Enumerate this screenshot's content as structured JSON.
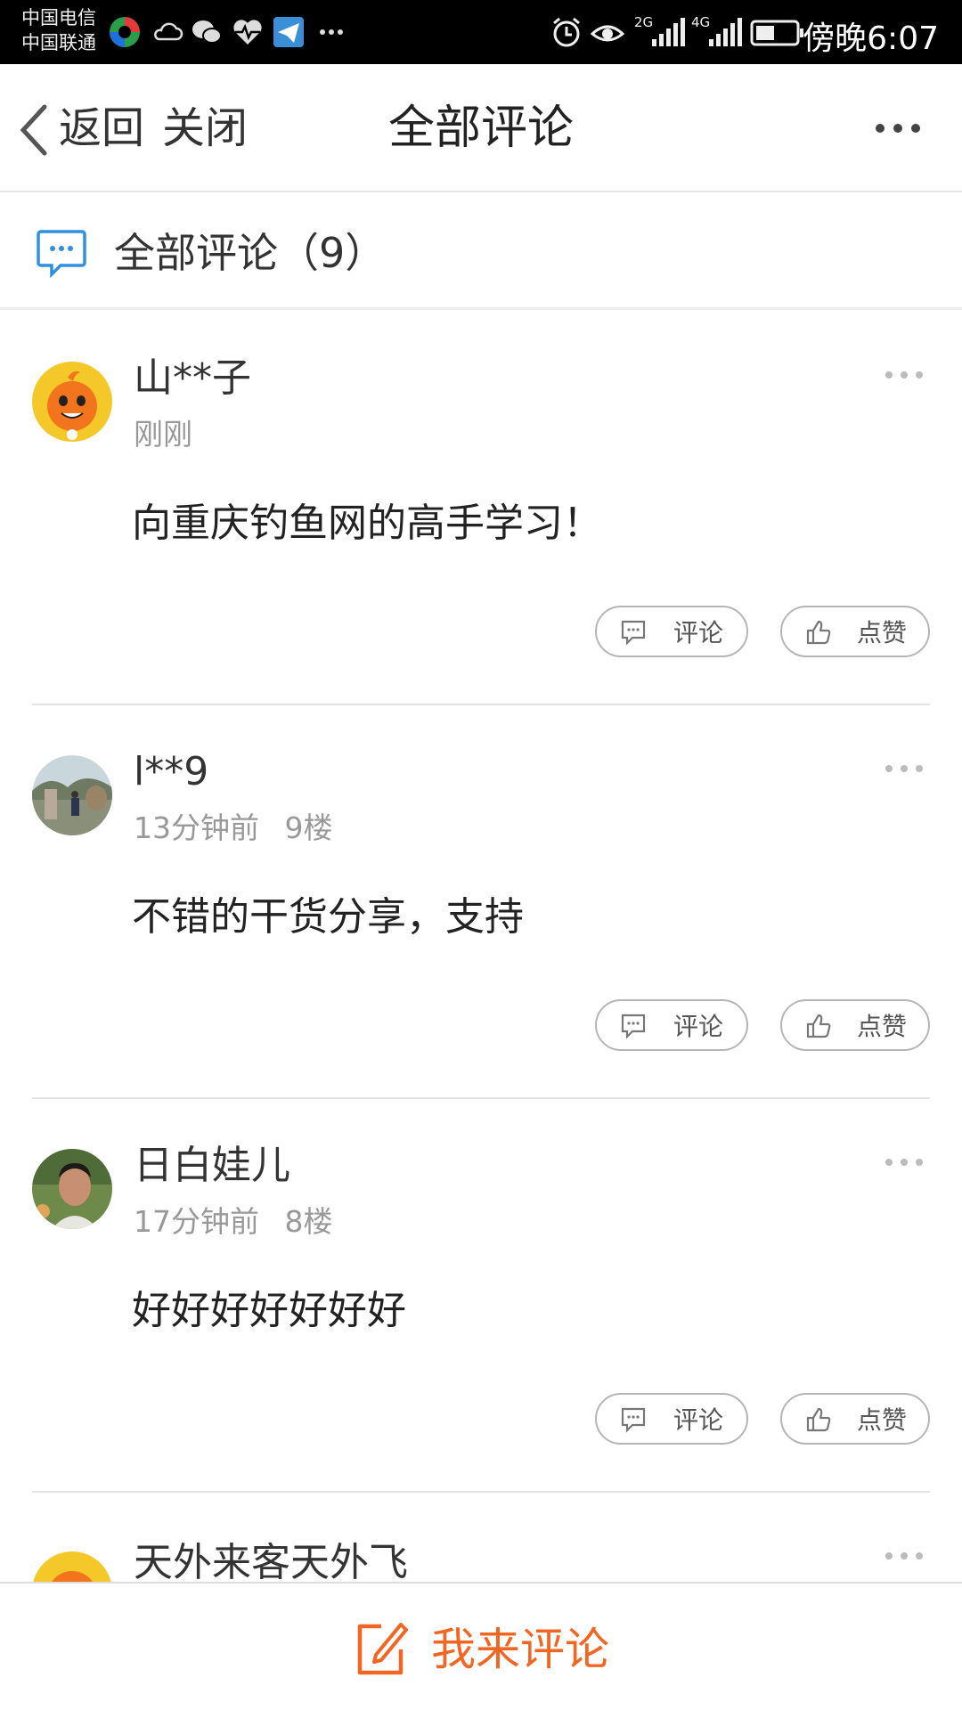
{
  "status_bar": {
    "carrier1": "中国电信",
    "carrier2": "中国联通",
    "network1": "2G",
    "network2": "4G",
    "time": "傍晚6:07",
    "icons": [
      "app-icon",
      "weather-icon",
      "wechat-icon",
      "health-icon",
      "telegram-icon",
      "more-dots-icon",
      "alarm-icon",
      "eye-icon",
      "signal-icon",
      "signal-icon",
      "battery-icon"
    ]
  },
  "header": {
    "back_label": "返回",
    "close_label": "关闭",
    "title": "全部评论"
  },
  "section": {
    "label": "全部评论（9）"
  },
  "comments": [
    {
      "user": "山**子",
      "time": "刚刚",
      "floor": "",
      "text": "向重庆钓鱼网的高手学习！",
      "reply_label": "评论",
      "like_label": "点赞"
    },
    {
      "user": "l**9",
      "time": "13分钟前",
      "floor": "9楼",
      "text": "不错的干货分享，支持",
      "reply_label": "评论",
      "like_label": "点赞"
    },
    {
      "user": "日白娃儿",
      "time": "17分钟前",
      "floor": "8楼",
      "text": "好好好好好好好",
      "reply_label": "评论",
      "like_label": "点赞"
    },
    {
      "user": "天外来客天外飞",
      "time": "",
      "floor": "",
      "text": "",
      "reply_label": "",
      "like_label": ""
    }
  ],
  "bottom_bar": {
    "label": "我来评论"
  },
  "colors": {
    "accent": "#f26522",
    "section_icon": "#2f8fe0",
    "text_secondary": "#999999"
  }
}
